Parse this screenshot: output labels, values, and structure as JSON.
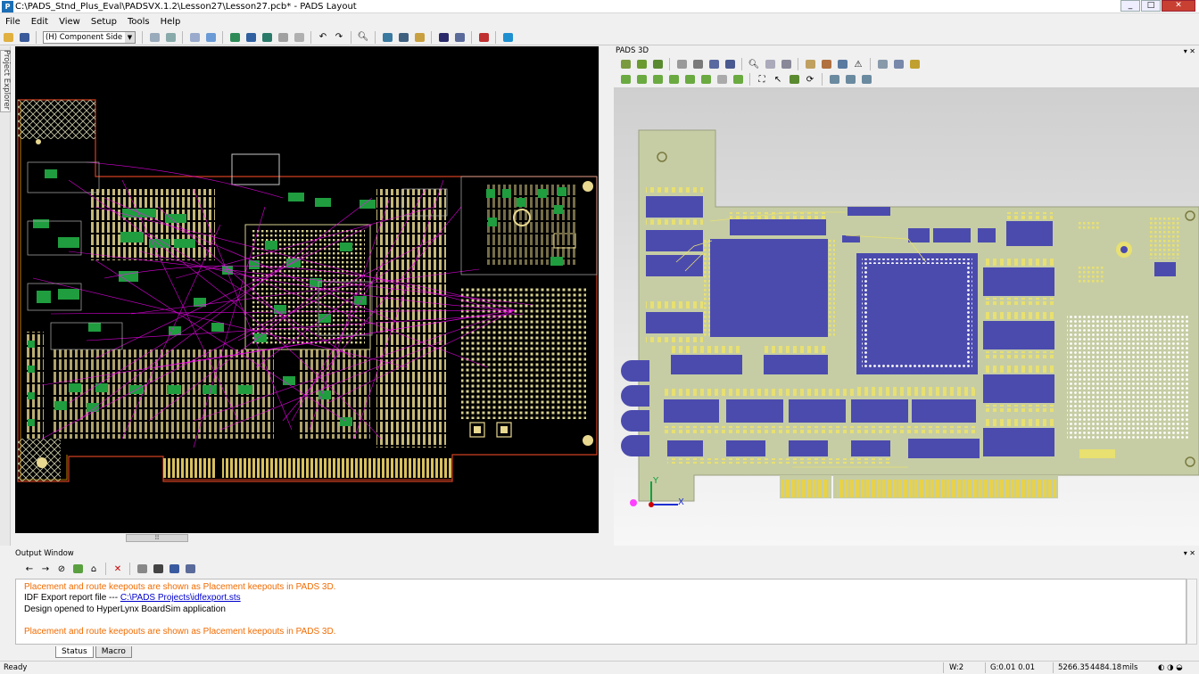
{
  "app": {
    "title": "C:\\PADS_Stnd_Plus_Eval\\PADSVX.1.2\\Lesson27\\Lesson27.pcb* - PADS Layout",
    "icon_label": "P"
  },
  "menu": [
    "File",
    "Edit",
    "View",
    "Setup",
    "Tools",
    "Help"
  ],
  "toolbar": {
    "layer": "(H) Component Side Layer"
  },
  "project_explorer": {
    "label": "Project Explorer"
  },
  "pads3d": {
    "title": "PADS 3D",
    "axis_x": "X",
    "axis_y": "Y"
  },
  "output": {
    "title": "Output Window",
    "messages": [
      {
        "text": "Placement and route keepouts are shown as Placement keepouts in PADS 3D.",
        "kind": "warning"
      },
      {
        "text": "IDF Export report file ---",
        "link": "C:\\PADS Projects\\idfexport.sts",
        "kind": "info"
      },
      {
        "text": "Design opened to HyperLynx BoardSim application",
        "kind": "info"
      },
      {
        "text": "",
        "kind": "blank"
      },
      {
        "text": "Placement and route keepouts are shown as Placement keepouts in PADS 3D.",
        "kind": "warning"
      }
    ],
    "tabs": [
      "Status",
      "Macro"
    ]
  },
  "status": {
    "ready": "Ready",
    "w": "W:2",
    "grid": "G:0.01 0.01",
    "x": "5266.35",
    "y": "4484.18",
    "units": "mils"
  },
  "colors": {
    "pcb_bg": "#000000",
    "trace": "#ff00ff",
    "pad": "#e8d890",
    "board3d": "#c6cda4",
    "component3d": "#4b4bae",
    "warning": "#f26b00"
  },
  "icons": [
    "open-icon",
    "save-icon",
    "copy-icon",
    "refresh-icon",
    "layer-icon",
    "route-icon",
    "grid-icon",
    "undo-icon",
    "redo-icon",
    "zoom-icon",
    "pan-icon",
    "measure-icon",
    "pads3d-icon"
  ]
}
